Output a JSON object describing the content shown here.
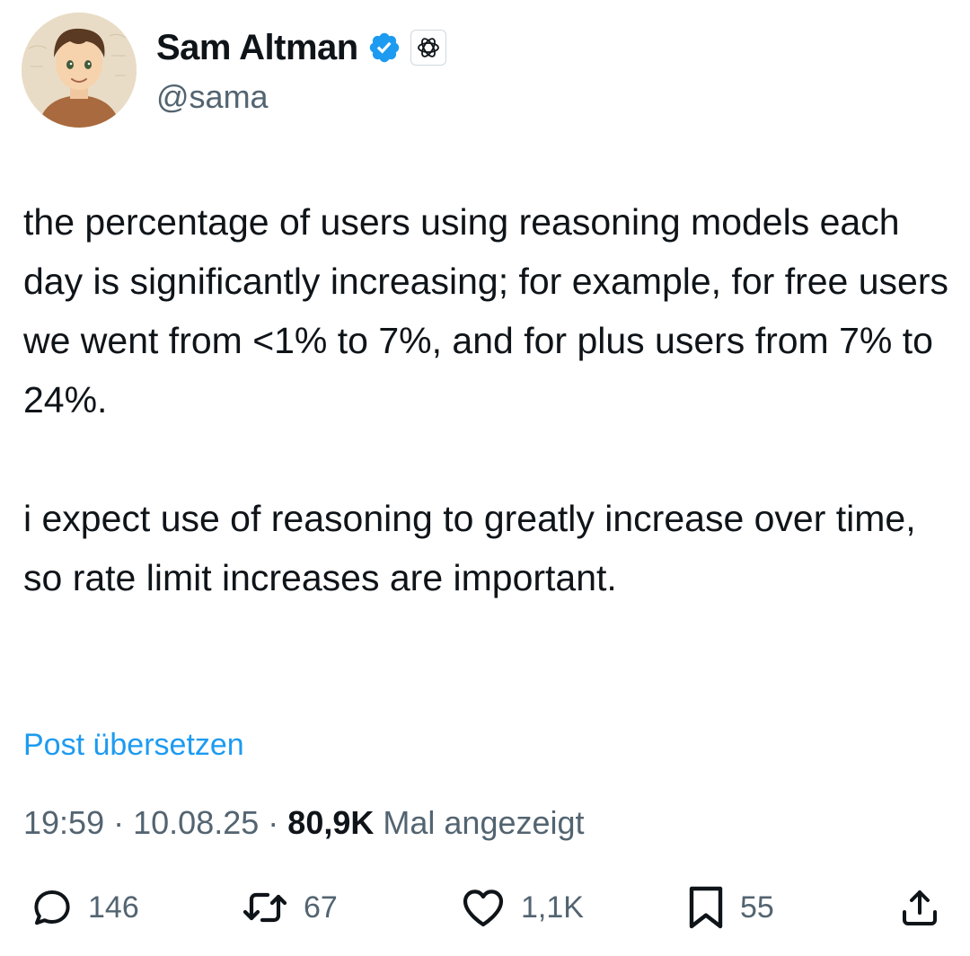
{
  "author": {
    "name": "Sam Altman",
    "handle": "@sama",
    "verified_icon": "verified-badge-icon",
    "affiliate_icon": "openai-logo-icon"
  },
  "tweet": {
    "paragraphs": [
      "the percentage of users using reasoning models each day is significantly increasing; for example, for free users we went from <1% to 7%, and for plus users from 7% to 24%.",
      "i expect use of reasoning to greatly increase over time, so rate limit increases are important."
    ],
    "translate_label": "Post übersetzen"
  },
  "meta": {
    "time": "19:59",
    "separator": "·",
    "date": "10.08.25",
    "views_count": "80,9K",
    "views_label": "Mal angezeigt"
  },
  "actions": {
    "reply_count": "146",
    "retweet_count": "67",
    "like_count": "1,1K",
    "bookmark_count": "55"
  },
  "colors": {
    "link": "#1d9bf0",
    "secondary_text": "#536471",
    "primary_text": "#0f1419",
    "verified": "#1d9bf0"
  }
}
